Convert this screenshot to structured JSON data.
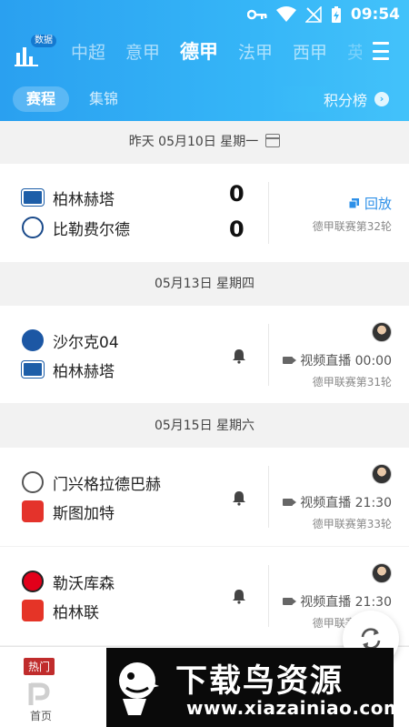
{
  "status_bar": {
    "time": "09:54"
  },
  "header": {
    "data_badge": "数据",
    "league_tabs": [
      "中超",
      "意甲",
      "德甲",
      "法甲",
      "西甲",
      "英"
    ],
    "active_league": "德甲",
    "sub_tabs": [
      "赛程",
      "集锦"
    ],
    "standings_label": "积分榜"
  },
  "sections": [
    {
      "date": "昨天 05月10日 星期一"
    },
    {
      "date": "05月13日 星期四"
    },
    {
      "date": "05月15日 星期六"
    }
  ],
  "matches": [
    {
      "home": "柏林赫塔",
      "away": "比勒费尔德",
      "home_score": "0",
      "away_score": "0",
      "action": "回放",
      "round": "德甲联赛第32轮"
    },
    {
      "home": "沙尔克04",
      "away": "柏林赫塔",
      "action": "视频直播 00:00",
      "round": "德甲联赛第31轮"
    },
    {
      "home": "门兴格拉德巴赫",
      "away": "斯图加特",
      "action": "视频直播 21:30",
      "round": "德甲联赛第33轮"
    },
    {
      "home": "勒沃库森",
      "away": "柏林联",
      "action": "视频直播 21:30",
      "round": "德甲联赛第33轮"
    }
  ],
  "bottom_nav": {
    "hot_tag": "热门",
    "home_label": "首页"
  },
  "watermark": {
    "title": "下载鸟资源",
    "url": "www.xiazainiao.com"
  },
  "colors": {
    "header": "#35b5f7",
    "accent": "#2e90e8",
    "hot": "#c02c2c"
  }
}
